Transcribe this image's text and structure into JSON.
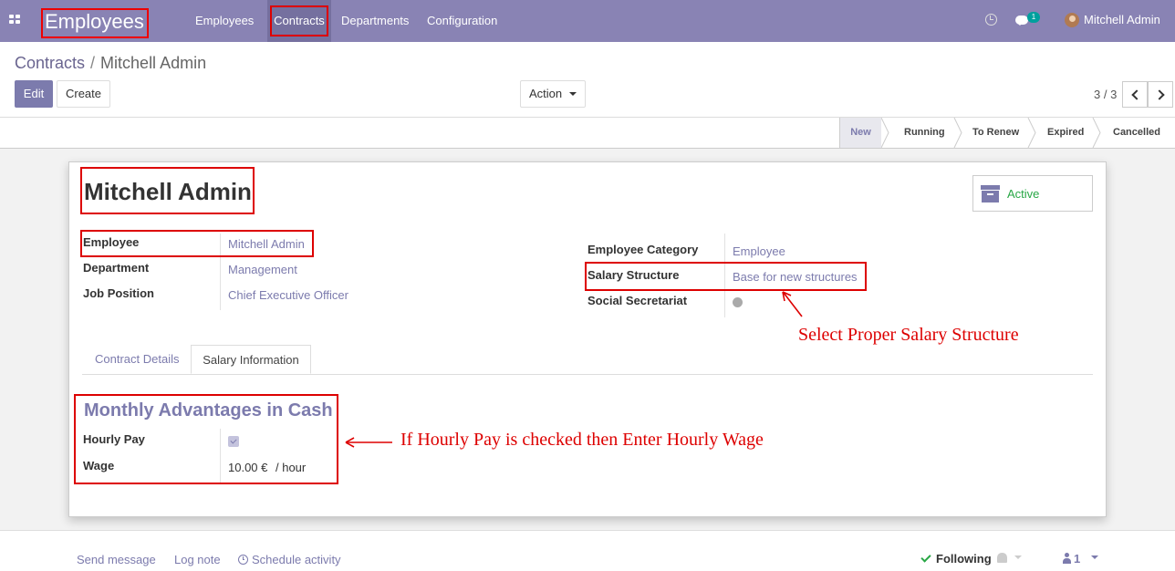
{
  "app": {
    "title": "Employees",
    "menu": [
      "Employees",
      "Contracts",
      "Departments",
      "Configuration"
    ],
    "badge": "1",
    "user": "Mitchell Admin"
  },
  "breadcrumb": {
    "parent": "Contracts",
    "separator": "/",
    "current": "Mitchell Admin"
  },
  "controls": {
    "edit": "Edit",
    "create": "Create",
    "action": "Action",
    "pager": "3 / 3"
  },
  "stages": [
    {
      "label": "New",
      "selected": true
    },
    {
      "label": "Running",
      "selected": false
    },
    {
      "label": "To Renew",
      "selected": false
    },
    {
      "label": "Expired",
      "selected": false
    },
    {
      "label": "Cancelled",
      "selected": false
    }
  ],
  "form": {
    "title": "Mitchell Admin",
    "active_label": "Active",
    "left_fields": [
      {
        "label": "Employee",
        "value": "Mitchell Admin"
      },
      {
        "label": "Department",
        "value": "Management"
      },
      {
        "label": "Job Position",
        "value": "Chief Executive Officer"
      }
    ],
    "right_fields": [
      {
        "label": "Employee Category",
        "value": "Employee"
      },
      {
        "label": "Salary Structure",
        "value": "Base for new structures"
      },
      {
        "label": "Social Secretariat",
        "value": ""
      }
    ],
    "tabs": [
      "Contract Details",
      "Salary Information"
    ],
    "section_title": "Monthly Advantages in Cash",
    "hourly_pay_label": "Hourly Pay",
    "hourly_pay_checked": true,
    "wage_label": "Wage",
    "wage_value": "10.00 €",
    "wage_unit": "/ hour"
  },
  "annotations": {
    "salary": "Select Proper Salary Structure",
    "hourly": "If Hourly Pay is checked then Enter Hourly Wage"
  },
  "chatter": {
    "send_message": "Send message",
    "log_note": "Log note",
    "schedule": "Schedule activity",
    "following": "Following",
    "followers": "1"
  },
  "colors": {
    "brand": "#8983b4",
    "accent": "#7c7bad",
    "annotation": "#dd0000"
  }
}
